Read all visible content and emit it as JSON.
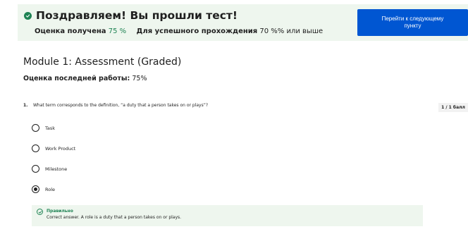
{
  "banner": {
    "title": "Поздравляем! Вы прошли тест!",
    "grade_label": "Оценка получена",
    "grade_value": "75 %",
    "pass_label": "Для успешного прохождения",
    "pass_value": "70 %% или выше",
    "check_icon": "check-circle-filled-icon",
    "accent_color": "#1f8354",
    "background_color": "#eef6ee"
  },
  "next_button": {
    "label": "Перейти к следующему пункту",
    "color": "#0056d2"
  },
  "module": {
    "title": "Module 1: Assessment (Graded)",
    "last_grade_label": "Оценка последней работы:",
    "last_grade_value": "75%"
  },
  "question": {
    "number": "1.",
    "text": "What term corresponds to the definition, “a duty that a person takes on or plays”?",
    "points": "1 / 1 балл",
    "options": [
      {
        "label": "Task",
        "selected": false
      },
      {
        "label": "Work Product",
        "selected": false
      },
      {
        "label": "Milestone",
        "selected": false
      },
      {
        "label": "Role",
        "selected": true
      }
    ],
    "feedback": {
      "title": "Правильно",
      "text": "Correct answer. A role is a duty that a person takes on or plays.",
      "icon": "check-circle-outline-icon"
    }
  }
}
